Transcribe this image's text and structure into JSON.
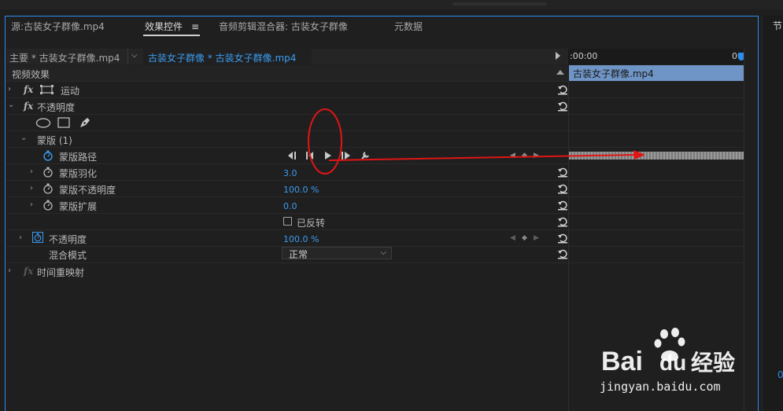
{
  "tabs": [
    {
      "label": "源:古装女子群像.mp4"
    },
    {
      "label": "效果控件"
    },
    {
      "label": "≡"
    },
    {
      "label": "音频剪辑混合器: 古装女子群像"
    },
    {
      "label": "元数据"
    }
  ],
  "side_panel": {
    "label": "节",
    "value": "0"
  },
  "clip_header": {
    "master": "主要 * 古装女子群像.mp4",
    "sequence": "古装女子群像 * 古装女子群像.mp4"
  },
  "timeline": {
    "start_time": ":00:00",
    "end_time": "00",
    "clip_name": "古装女子群像.mp4"
  },
  "section_title": "视频效果",
  "effects": {
    "motion": {
      "label": "运动"
    },
    "opacity": {
      "label": "不透明度"
    },
    "mask": {
      "label": "蒙版 (1)"
    },
    "mask_path": {
      "label": "蒙版路径"
    },
    "mask_feather": {
      "label": "蒙版羽化",
      "value": "3.0"
    },
    "mask_opacity": {
      "label": "蒙版不透明度",
      "value": "100.0 %"
    },
    "mask_expansion": {
      "label": "蒙版扩展",
      "value": "0.0"
    },
    "inverted": {
      "label": "已反转",
      "checked": false
    },
    "opacity_prop": {
      "label": "不透明度",
      "value": "100.0 %"
    },
    "blend_mode": {
      "label": "混合模式",
      "value": "正常"
    },
    "time_remap": {
      "label": "时间重映射"
    }
  },
  "watermark": {
    "brand": "Bai",
    "brand2": "du",
    "suffix": "经验",
    "url": "jingyan.baidu.com"
  },
  "colors": {
    "accent": "#2d8ceb",
    "value_blue": "#3b9cf0",
    "annotation_red": "#e01515",
    "clip_blue": "#6f95c6"
  }
}
